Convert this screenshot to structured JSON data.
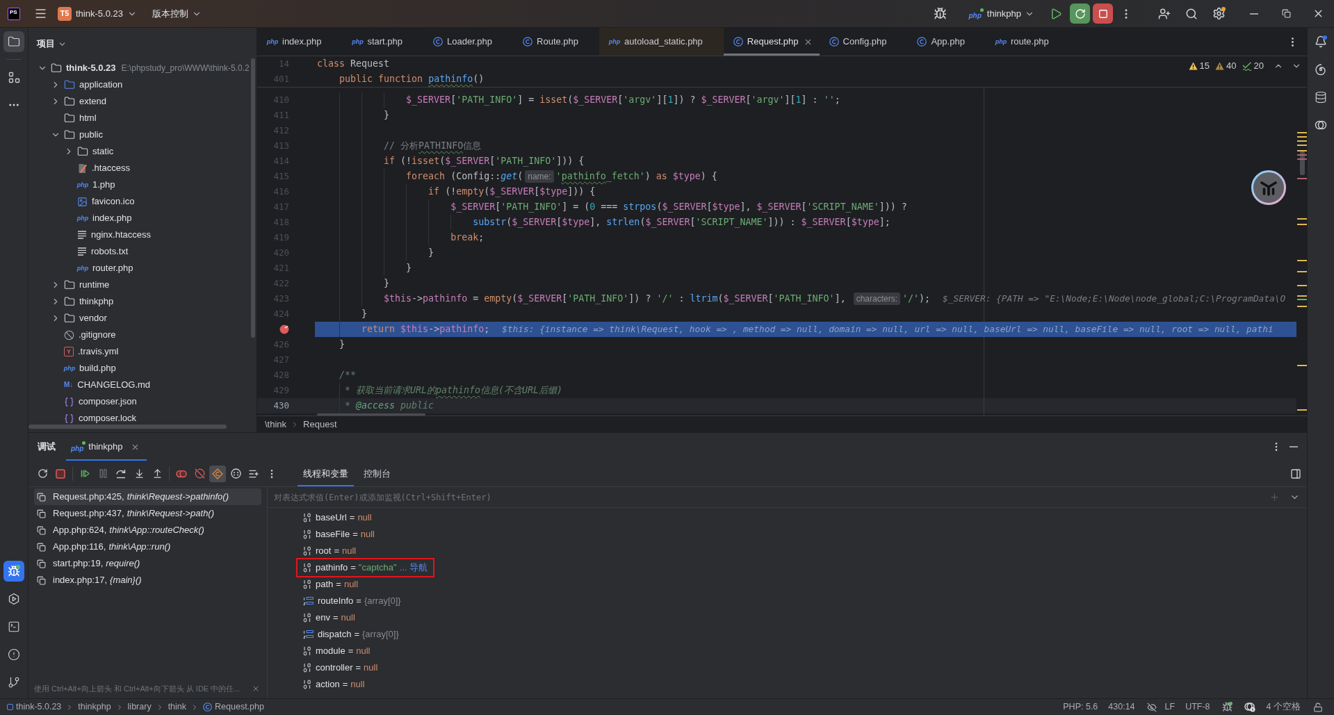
{
  "title_bar": {
    "app_logo": "PS",
    "project_badge": "T5",
    "project": "think-5.0.23",
    "vcs": "版本控制",
    "run_config_icon": "php",
    "run_config": "thinkphp"
  },
  "left_strip": {
    "top": [
      {
        "selected": true,
        "focused": false
      },
      {
        "selected": false
      }
    ],
    "bottom": [
      {
        "selected": true,
        "focused": true
      },
      {
        "selected": false
      },
      {
        "selected": false
      },
      {
        "selected": false
      },
      {
        "selected": false
      }
    ]
  },
  "project_panel": {
    "title": "项目",
    "tree": [
      {
        "label": "think-5.0.23",
        "hint": "E:\\phpstudy_pro\\WWW\\think-5.0.2",
        "kind": "folder",
        "expanded": true,
        "children": [
          {
            "label": "application",
            "kind": "source_folder",
            "expanded": false
          },
          {
            "label": "extend",
            "kind": "folder",
            "expanded": false
          },
          {
            "label": "html",
            "kind": "empty_folder"
          },
          {
            "label": "public",
            "kind": "folder",
            "expanded": true,
            "children": [
              {
                "label": "static",
                "kind": "folder",
                "expanded": false
              },
              {
                "label": ".htaccess",
                "kind": "htaccess"
              },
              {
                "label": "1.php",
                "kind": "php",
                "icon_text": "php"
              },
              {
                "label": "favicon.ico",
                "kind": "image"
              },
              {
                "label": "index.php",
                "kind": "php",
                "icon_text": "php"
              },
              {
                "label": "nginx.htaccess",
                "kind": "text"
              },
              {
                "label": "robots.txt",
                "kind": "text"
              },
              {
                "label": "router.php",
                "kind": "php",
                "icon_text": "php"
              }
            ]
          },
          {
            "label": "runtime",
            "kind": "folder",
            "expanded": false
          },
          {
            "label": "thinkphp",
            "kind": "folder",
            "expanded": false
          },
          {
            "label": "vendor",
            "kind": "folder",
            "expanded": false
          },
          {
            "label": ".gitignore",
            "kind": "ignore"
          },
          {
            "label": ".travis.yml",
            "kind": "yaml",
            "icon_text": "Y"
          },
          {
            "label": "build.php",
            "kind": "php",
            "icon_text": "php"
          },
          {
            "label": "CHANGELOG.md",
            "kind": "markdown",
            "icon_text": "M↓"
          },
          {
            "label": "composer.json",
            "kind": "json"
          },
          {
            "label": "composer.lock",
            "kind": "json"
          }
        ]
      }
    ]
  },
  "editor": {
    "tabs": [
      {
        "label": "index.php",
        "kind": "php",
        "icon_text": "php",
        "selected": false
      },
      {
        "label": "start.php",
        "kind": "php",
        "icon_text": "php",
        "selected": false
      },
      {
        "label": "Loader.php",
        "kind": "class",
        "selected": false
      },
      {
        "label": "Route.php",
        "kind": "class",
        "selected": false
      },
      {
        "label": "autoload_static.php",
        "kind": "php",
        "icon_text": "php",
        "selected": false,
        "color": "#2d2721"
      },
      {
        "label": "Request.php",
        "kind": "class",
        "selected": true
      },
      {
        "label": "Config.php",
        "kind": "class",
        "selected": false
      },
      {
        "label": "App.php",
        "kind": "class",
        "selected": false
      },
      {
        "label": "route.php",
        "kind": "php",
        "icon_text": "php",
        "selected": false
      }
    ],
    "inspections": [
      {
        "kind": "warning",
        "count": "15"
      },
      {
        "kind": "weak_warning",
        "count": "40"
      },
      {
        "kind": "typo",
        "count": "20"
      }
    ],
    "sticky_lines": [
      {
        "number": "14",
        "tokens": [
          {
            "kind": "keyword",
            "text": "class"
          },
          {
            "kind": "plain",
            "text": " Request"
          }
        ]
      },
      {
        "number": "401",
        "tokens": [
          {
            "kind": "keyword",
            "text": "    public function"
          },
          {
            "kind": "function",
            "text": " pathinfo",
            "typo": true
          },
          {
            "kind": "plain",
            "text": "()"
          }
        ]
      }
    ],
    "lines": [
      {
        "number": "410",
        "breakpoint": false,
        "execution": false,
        "caret": false,
        "tokens": [
          {
            "kind": "variable",
            "text": "                $_SERVER"
          },
          {
            "kind": "plain",
            "text": "["
          },
          {
            "kind": "string",
            "text": "'PATH_INFO'"
          },
          {
            "kind": "plain",
            "text": "] = "
          },
          {
            "kind": "keyword",
            "text": "isset"
          },
          {
            "kind": "plain",
            "text": "("
          },
          {
            "kind": "variable",
            "text": "$_SERVER"
          },
          {
            "kind": "plain",
            "text": "["
          },
          {
            "kind": "string",
            "text": "'argv'"
          },
          {
            "kind": "plain",
            "text": "]["
          },
          {
            "kind": "number",
            "text": "1"
          },
          {
            "kind": "plain",
            "text": "]) ? "
          },
          {
            "kind": "variable",
            "text": "$_SERVER"
          },
          {
            "kind": "plain",
            "text": "["
          },
          {
            "kind": "string",
            "text": "'argv'"
          },
          {
            "kind": "plain",
            "text": "]["
          },
          {
            "kind": "number",
            "text": "1"
          },
          {
            "kind": "plain",
            "text": "] : "
          },
          {
            "kind": "string",
            "text": "''"
          },
          {
            "kind": "plain",
            "text": ";"
          }
        ]
      },
      {
        "number": "411",
        "breakpoint": false,
        "execution": false,
        "caret": false,
        "tokens": [
          {
            "kind": "plain",
            "text": "            }"
          }
        ]
      },
      {
        "number": "412",
        "breakpoint": false,
        "execution": false,
        "caret": false
      },
      {
        "number": "413",
        "breakpoint": false,
        "execution": false,
        "caret": false,
        "tokens": [
          {
            "kind": "comment",
            "text": "            // 分析"
          },
          {
            "kind": "comment",
            "text": "PATHINFO",
            "typo": true
          },
          {
            "kind": "comment",
            "text": "信息"
          }
        ]
      },
      {
        "number": "414",
        "breakpoint": false,
        "execution": false,
        "caret": false,
        "tokens": [
          {
            "kind": "keyword",
            "text": "            if"
          },
          {
            "kind": "plain",
            "text": " (!"
          },
          {
            "kind": "keyword",
            "text": "isset"
          },
          {
            "kind": "plain",
            "text": "("
          },
          {
            "kind": "variable",
            "text": "$_SERVER"
          },
          {
            "kind": "plain",
            "text": "["
          },
          {
            "kind": "string",
            "text": "'PATH_INFO'"
          },
          {
            "kind": "plain",
            "text": "])) {"
          }
        ]
      },
      {
        "number": "415",
        "breakpoint": false,
        "execution": false,
        "caret": false,
        "tokens": [
          {
            "kind": "keyword",
            "text": "                foreach"
          },
          {
            "kind": "plain",
            "text": " (Config::"
          },
          {
            "kind": "static_call",
            "text": "get"
          },
          {
            "kind": "plain",
            "text": "("
          },
          {
            "kind": "hint",
            "text": "name:"
          },
          {
            "kind": "string",
            "text": "'"
          },
          {
            "kind": "string",
            "text": "pathinfo",
            "typo": true
          },
          {
            "kind": "string",
            "text": "_fetch'"
          },
          {
            "kind": "plain",
            "text": ") "
          },
          {
            "kind": "keyword",
            "text": "as"
          },
          {
            "kind": "variable",
            "text": " $type"
          },
          {
            "kind": "plain",
            "text": ") {"
          }
        ]
      },
      {
        "number": "416",
        "breakpoint": false,
        "execution": false,
        "caret": false,
        "tokens": [
          {
            "kind": "keyword",
            "text": "                    if"
          },
          {
            "kind": "plain",
            "text": " (!"
          },
          {
            "kind": "keyword",
            "text": "empty"
          },
          {
            "kind": "plain",
            "text": "("
          },
          {
            "kind": "variable",
            "text": "$_SERVER"
          },
          {
            "kind": "plain",
            "text": "["
          },
          {
            "kind": "variable",
            "text": "$type"
          },
          {
            "kind": "plain",
            "text": "])) {"
          }
        ]
      },
      {
        "number": "417",
        "breakpoint": false,
        "execution": false,
        "caret": false,
        "tokens": [
          {
            "kind": "variable",
            "text": "                        $_SERVER"
          },
          {
            "kind": "plain",
            "text": "["
          },
          {
            "kind": "string",
            "text": "'PATH_INFO'"
          },
          {
            "kind": "plain",
            "text": "] = ("
          },
          {
            "kind": "number",
            "text": "0"
          },
          {
            "kind": "plain",
            "text": " === "
          },
          {
            "kind": "function",
            "text": "strpos"
          },
          {
            "kind": "plain",
            "text": "("
          },
          {
            "kind": "variable",
            "text": "$_SERVER"
          },
          {
            "kind": "plain",
            "text": "["
          },
          {
            "kind": "variable",
            "text": "$type"
          },
          {
            "kind": "plain",
            "text": "], "
          },
          {
            "kind": "variable",
            "text": "$_SERVER"
          },
          {
            "kind": "plain",
            "text": "["
          },
          {
            "kind": "string",
            "text": "'SCRIPT_NAME'"
          },
          {
            "kind": "plain",
            "text": "])) ?"
          }
        ]
      },
      {
        "number": "418",
        "breakpoint": false,
        "execution": false,
        "caret": false,
        "tokens": [
          {
            "kind": "function",
            "text": "                            substr"
          },
          {
            "kind": "plain",
            "text": "("
          },
          {
            "kind": "variable",
            "text": "$_SERVER"
          },
          {
            "kind": "plain",
            "text": "["
          },
          {
            "kind": "variable",
            "text": "$type"
          },
          {
            "kind": "plain",
            "text": "], "
          },
          {
            "kind": "function",
            "text": "strlen"
          },
          {
            "kind": "plain",
            "text": "("
          },
          {
            "kind": "variable",
            "text": "$_SERVER"
          },
          {
            "kind": "plain",
            "text": "["
          },
          {
            "kind": "string",
            "text": "'SCRIPT_NAME'"
          },
          {
            "kind": "plain",
            "text": "])) : "
          },
          {
            "kind": "variable",
            "text": "$_SERVER"
          },
          {
            "kind": "plain",
            "text": "["
          },
          {
            "kind": "variable",
            "text": "$type"
          },
          {
            "kind": "plain",
            "text": "];"
          }
        ]
      },
      {
        "number": "419",
        "breakpoint": false,
        "execution": false,
        "caret": false,
        "tokens": [
          {
            "kind": "keyword",
            "text": "                        break"
          },
          {
            "kind": "plain",
            "text": ";"
          }
        ]
      },
      {
        "number": "420",
        "breakpoint": false,
        "execution": false,
        "caret": false,
        "tokens": [
          {
            "kind": "plain",
            "text": "                    }"
          }
        ]
      },
      {
        "number": "421",
        "breakpoint": false,
        "execution": false,
        "caret": false,
        "tokens": [
          {
            "kind": "plain",
            "text": "                }"
          }
        ]
      },
      {
        "number": "422",
        "breakpoint": false,
        "execution": false,
        "caret": false,
        "tokens": [
          {
            "kind": "plain",
            "text": "            }"
          }
        ]
      },
      {
        "number": "423",
        "breakpoint": false,
        "execution": false,
        "caret": false,
        "tokens": [
          {
            "kind": "variable",
            "text": "            $this"
          },
          {
            "kind": "plain",
            "text": "->"
          },
          {
            "kind": "variable",
            "text": "pathinfo"
          },
          {
            "kind": "plain",
            "text": " = "
          },
          {
            "kind": "keyword",
            "text": "empty"
          },
          {
            "kind": "plain",
            "text": "("
          },
          {
            "kind": "variable",
            "text": "$_SERVER"
          },
          {
            "kind": "plain",
            "text": "["
          },
          {
            "kind": "string",
            "text": "'PATH_INFO'"
          },
          {
            "kind": "plain",
            "text": "]) ? "
          },
          {
            "kind": "string",
            "text": "'/'"
          },
          {
            "kind": "plain",
            "text": " : "
          },
          {
            "kind": "function",
            "text": "ltrim"
          },
          {
            "kind": "plain",
            "text": "("
          },
          {
            "kind": "variable",
            "text": "$_SERVER"
          },
          {
            "kind": "plain",
            "text": "["
          },
          {
            "kind": "string",
            "text": "'PATH_INFO'"
          },
          {
            "kind": "plain",
            "text": "], "
          },
          {
            "kind": "hint",
            "text": "characters:"
          },
          {
            "kind": "string",
            "text": "'/'"
          },
          {
            "kind": "plain",
            "text": ");"
          },
          {
            "kind": "inline_value",
            "text": "$_SERVER: {PATH => \"E:\\Node;E:\\Node\\node_global;C:\\ProgramData\\O"
          }
        ]
      },
      {
        "number": "424",
        "breakpoint": false,
        "execution": false,
        "caret": false,
        "tokens": [
          {
            "kind": "plain",
            "text": "        }"
          }
        ]
      },
      {
        "breakpoint": true,
        "execution": true,
        "caret": false,
        "tokens": [
          {
            "kind": "keyword",
            "text": "        return"
          },
          {
            "kind": "variable",
            "text": " $this"
          },
          {
            "kind": "plain",
            "text": "->"
          },
          {
            "kind": "variable",
            "text": "pathinfo"
          },
          {
            "kind": "plain",
            "text": ";"
          },
          {
            "kind": "inline_value",
            "text": "$this: {instance => think\\Request, hook => , method => null, domain => null, url => null, baseUrl => null, baseFile => null, root => null, pathi"
          }
        ]
      },
      {
        "number": "426",
        "breakpoint": false,
        "execution": false,
        "caret": false,
        "tokens": [
          {
            "kind": "plain",
            "text": "    }"
          }
        ]
      },
      {
        "number": "427",
        "breakpoint": false,
        "execution": false,
        "caret": false
      },
      {
        "number": "428",
        "breakpoint": false,
        "execution": false,
        "caret": false,
        "tokens": [
          {
            "kind": "doc",
            "text": "    /**"
          }
        ]
      },
      {
        "number": "429",
        "breakpoint": false,
        "execution": false,
        "caret": false,
        "tokens": [
          {
            "kind": "doc",
            "text": "     * 获取当前请求URL的"
          },
          {
            "kind": "doc",
            "text": "pathinfo",
            "typo": true
          },
          {
            "kind": "doc",
            "text": "信息(不含URL后缀)"
          }
        ]
      },
      {
        "number": "430",
        "breakpoint": false,
        "execution": false,
        "caret": true,
        "tokens": [
          {
            "kind": "doc",
            "text": "     * "
          },
          {
            "kind": "doc_tag",
            "text": "@access"
          },
          {
            "kind": "doc",
            "text": " public"
          }
        ]
      }
    ],
    "breadcrumbs": [
      "\\think",
      "Request"
    ]
  },
  "debugger": {
    "title": "调试",
    "sessions": [
      {
        "label": "thinkphp",
        "icon_text": "php",
        "selected": true
      }
    ],
    "toolbar_toggles": [
      {
        "on": false
      },
      {
        "on": true
      }
    ],
    "views": [
      {
        "label": "线程和变量",
        "selected": true
      },
      {
        "label": "控制台",
        "selected": false
      }
    ],
    "frames": [
      {
        "location": "Request.php:425,",
        "function": "think\\Request->pathinfo()",
        "selected": true
      },
      {
        "location": "Request.php:437,",
        "function": "think\\Request->path()",
        "selected": false
      },
      {
        "location": "App.php:624,",
        "function": "think\\App::routeCheck()",
        "selected": false
      },
      {
        "location": "App.php:116,",
        "function": "think\\App::run()",
        "selected": false
      },
      {
        "location": "start.php:19,",
        "function": "require()",
        "selected": false
      },
      {
        "location": "index.php:17,",
        "function": "{main}()",
        "selected": false
      }
    ],
    "hint": "使用 Ctrl+Alt+向上箭头 和 Ctrl+Alt+向下箭头 从 IDE 中的任...",
    "evaluate": {
      "placeholder": "对表达式求值(Enter)或添加监视(Ctrl+Shift+Enter)"
    },
    "variables": [
      {
        "name": "baseUrl",
        "operator": "=",
        "value": "null",
        "kind": "null",
        "highlighted": false
      },
      {
        "name": "baseFile",
        "operator": "=",
        "value": "null",
        "kind": "null",
        "highlighted": false
      },
      {
        "name": "root",
        "operator": "=",
        "value": "null",
        "kind": "null",
        "highlighted": false
      },
      {
        "name": "pathinfo",
        "operator": "=",
        "value": "\"captcha\"",
        "kind": "string",
        "link": "... 导航",
        "highlighted": true
      },
      {
        "name": "path",
        "operator": "=",
        "value": "null",
        "kind": "null",
        "highlighted": false
      },
      {
        "name": "routeInfo",
        "operator": "=",
        "value": "{array[0]}",
        "kind": "array",
        "highlighted": false
      },
      {
        "name": "env",
        "operator": "=",
        "value": "null",
        "kind": "null",
        "highlighted": false
      },
      {
        "name": "dispatch",
        "operator": "=",
        "value": "{array[0]}",
        "kind": "array",
        "highlighted": false
      },
      {
        "name": "module",
        "operator": "=",
        "value": "null",
        "kind": "null",
        "highlighted": false
      },
      {
        "name": "controller",
        "operator": "=",
        "value": "null",
        "kind": "null",
        "highlighted": false
      },
      {
        "name": "action",
        "operator": "=",
        "value": "null",
        "kind": "null",
        "highlighted": false
      }
    ]
  },
  "status_bar": {
    "path": [
      {
        "label": "think-5.0.23",
        "kind": "module"
      },
      {
        "label": "thinkphp",
        "kind": "directory"
      },
      {
        "label": "library",
        "kind": "directory"
      },
      {
        "label": "think",
        "kind": "directory"
      },
      {
        "label": "Request.php",
        "kind": "class"
      }
    ],
    "php_version": "PHP: 5.6",
    "position": "430:14",
    "line_separator": "LF",
    "encoding": "UTF-8",
    "indent": "4 个空格"
  }
}
